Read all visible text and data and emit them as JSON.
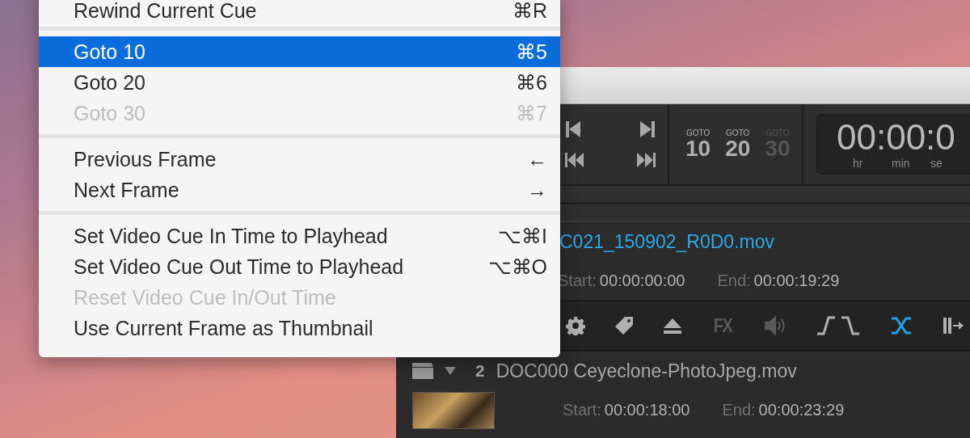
{
  "menu": {
    "items": [
      {
        "kind": "item",
        "label": "Rewind Current Cue",
        "shortcut": "⌘R",
        "selected": false,
        "disabled": false
      },
      {
        "kind": "separator"
      },
      {
        "kind": "item",
        "label": "Goto 10",
        "shortcut": "⌘5",
        "selected": true,
        "disabled": false
      },
      {
        "kind": "item",
        "label": "Goto 20",
        "shortcut": "⌘6",
        "selected": false,
        "disabled": false
      },
      {
        "kind": "item",
        "label": "Goto 30",
        "shortcut": "⌘7",
        "selected": false,
        "disabled": true
      },
      {
        "kind": "separator"
      },
      {
        "kind": "item",
        "label": "Previous Frame",
        "shortcut": "←",
        "selected": false,
        "disabled": false
      },
      {
        "kind": "item",
        "label": "Next Frame",
        "shortcut": "→",
        "selected": false,
        "disabled": false
      },
      {
        "kind": "separator"
      },
      {
        "kind": "item",
        "label": "Set Video Cue In Time to Playhead",
        "shortcut": "⌥⌘I",
        "selected": false,
        "disabled": false
      },
      {
        "kind": "item",
        "label": "Set Video Cue Out Time to Playhead",
        "shortcut": "⌥⌘O",
        "selected": false,
        "disabled": false
      },
      {
        "kind": "item",
        "label": "Reset Video Cue In/Out Time",
        "selected": false,
        "disabled": true
      },
      {
        "kind": "item",
        "label": "Use Current Frame as Thumbnail",
        "selected": false,
        "disabled": false
      }
    ]
  },
  "window": {
    "gotos": [
      {
        "caption": "GOTO",
        "number": "10",
        "disabled": false
      },
      {
        "caption": "GOTO",
        "number": "20",
        "disabled": false
      },
      {
        "caption": "GOTO",
        "number": "30",
        "disabled": true
      }
    ],
    "timecode": {
      "value": "00:00:0",
      "units": [
        "hr",
        "min",
        "se"
      ]
    },
    "cues": [
      {
        "selected": true,
        "name": "C021_150902_R0D0.mov",
        "start_label": "Start:",
        "start": "00:00:00:00",
        "end_label": "End:",
        "end": "00:00:19:29"
      },
      {
        "selected": false,
        "number": "2",
        "name": "DOC000 Ceyeclone-PhotoJpeg.mov",
        "start_label": "Start:",
        "start": "00:00:18:00",
        "end_label": "End:",
        "end": "00:00:23:29"
      }
    ],
    "cue_tools": [
      {
        "kind": "gear",
        "disabled": false,
        "active": false
      },
      {
        "kind": "tag",
        "disabled": false,
        "active": false
      },
      {
        "kind": "eject",
        "disabled": false,
        "active": false
      },
      {
        "kind": "fx",
        "label": "FX",
        "disabled": true,
        "active": false
      },
      {
        "kind": "speaker",
        "disabled": true,
        "active": false
      },
      {
        "kind": "fades",
        "disabled": false,
        "active": false
      },
      {
        "kind": "crossfade",
        "disabled": false,
        "active": true
      },
      {
        "kind": "play-to",
        "disabled": false,
        "active": false
      }
    ]
  }
}
